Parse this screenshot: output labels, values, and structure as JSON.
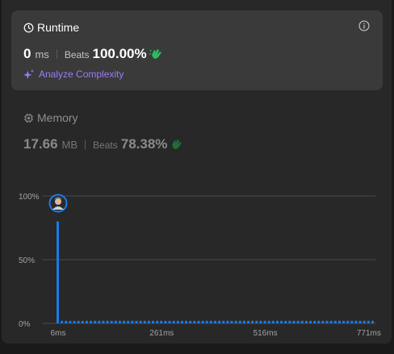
{
  "runtime": {
    "title": "Runtime",
    "value": "0",
    "unit": "ms",
    "beats_label": "Beats",
    "beats_value": "100.00%",
    "analyze_label": "Analyze Complexity"
  },
  "memory": {
    "title": "Memory",
    "value": "17.66",
    "unit": "MB",
    "beats_label": "Beats",
    "beats_value": "78.38%"
  },
  "colors": {
    "accent_blue": "#1b7be8",
    "purple": "#9b7cf7",
    "green": "#2cbb5d"
  },
  "chart_data": {
    "type": "bar",
    "y_ticks": [
      "100%",
      "50%",
      "0%"
    ],
    "x_tick_labels": [
      "6ms",
      "261ms",
      "516ms",
      "771ms"
    ],
    "ylim": [
      0,
      100
    ],
    "first_bar_value": 80,
    "other_bar_value": 2,
    "bar_count": 77,
    "marker": "avatar at the 6ms bar"
  }
}
